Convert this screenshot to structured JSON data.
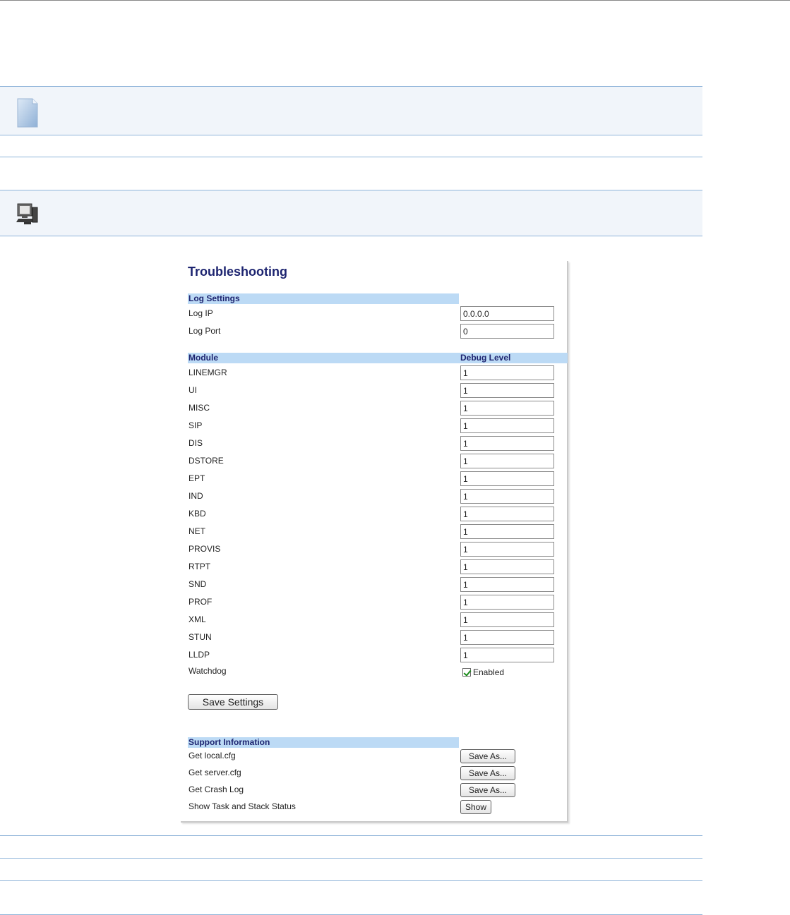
{
  "panel": {
    "title": "Troubleshooting",
    "log_settings": {
      "header": "Log Settings",
      "rows": [
        {
          "label": "Log IP",
          "value": "0.0.0.0"
        },
        {
          "label": "Log Port",
          "value": "0"
        }
      ]
    },
    "modules": {
      "header_module": "Module",
      "header_debug": "Debug Level",
      "rows": [
        {
          "label": "LINEMGR",
          "value": "1"
        },
        {
          "label": "UI",
          "value": "1"
        },
        {
          "label": "MISC",
          "value": "1"
        },
        {
          "label": "SIP",
          "value": "1"
        },
        {
          "label": "DIS",
          "value": "1"
        },
        {
          "label": "DSTORE",
          "value": "1"
        },
        {
          "label": "EPT",
          "value": "1"
        },
        {
          "label": "IND",
          "value": "1"
        },
        {
          "label": "KBD",
          "value": "1"
        },
        {
          "label": "NET",
          "value": "1"
        },
        {
          "label": "PROVIS",
          "value": "1"
        },
        {
          "label": "RTPT",
          "value": "1"
        },
        {
          "label": "SND",
          "value": "1"
        },
        {
          "label": "PROF",
          "value": "1"
        },
        {
          "label": "XML",
          "value": "1"
        },
        {
          "label": "STUN",
          "value": "1"
        },
        {
          "label": "LLDP",
          "value": "1"
        }
      ],
      "watchdog": {
        "label": "Watchdog",
        "checkbox_label": "Enabled",
        "checked": true
      }
    },
    "save_settings_label": "Save Settings",
    "support": {
      "header": "Support Information",
      "rows": [
        {
          "label": "Get local.cfg",
          "button": "Save As..."
        },
        {
          "label": "Get server.cfg",
          "button": "Save As..."
        },
        {
          "label": "Get Crash Log",
          "button": "Save As..."
        },
        {
          "label": "Show Task and Stack Status",
          "button": "Show"
        }
      ]
    }
  },
  "icons": {
    "note": "note-icon",
    "computer": "computer-icon"
  },
  "colors": {
    "section_header_bg": "#bcdaf5",
    "title": "#1d2470",
    "rule": "#8fb4d9",
    "band_bg": "#f1f5fa"
  }
}
